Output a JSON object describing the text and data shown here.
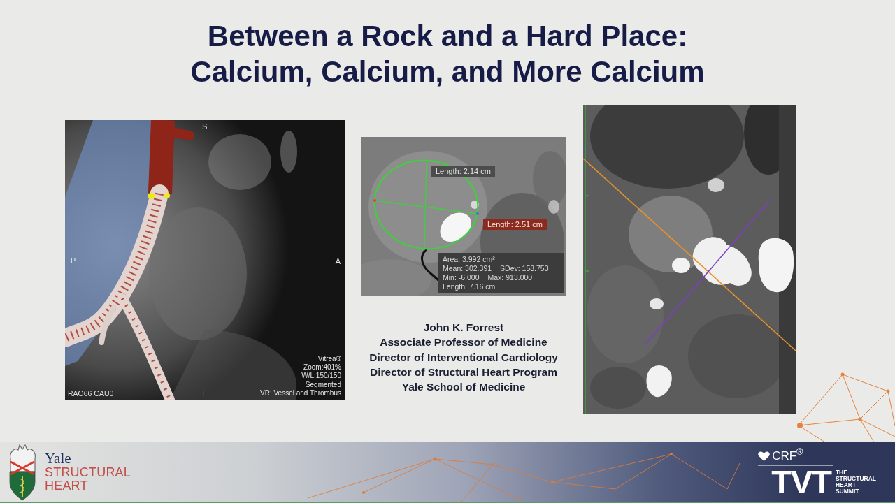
{
  "slide": {
    "title": [
      "Between a Rock and a Hard Place:",
      "Calcium, Calcium, and More Calcium"
    ]
  },
  "figures": [
    {
      "kind": "volume_render",
      "orientation_labels": {
        "top": "S",
        "left": "P",
        "right": "A",
        "bottom": "I"
      },
      "view": "RAO66 CAU0",
      "info": [
        "Vitrea®",
        "Zoom:401%",
        "W/L:150/150",
        "Segmented",
        "VR: Vessel and Thrombus"
      ]
    },
    {
      "kind": "measurement",
      "length_labels": [
        {
          "text": "Length: 2.14 cm",
          "highlighted": false
        },
        {
          "text": "Length: 2.51 cm",
          "highlighted": true
        }
      ],
      "stats": [
        [
          "Area: 3.992 cm²"
        ],
        [
          "Mean: 302.391",
          "SDev: 158.753"
        ],
        [
          "Min: -6.000",
          "Max: 913.000"
        ],
        [
          "Length: 7.16 cm"
        ]
      ]
    },
    {
      "kind": "ct_slice"
    }
  ],
  "speaker": {
    "name": "John K. Forrest",
    "titles": [
      "Associate Professor of Medicine",
      "Director of Interventional Cardiology",
      "Director of Structural Heart Program",
      "Yale School of Medicine"
    ]
  },
  "footer": {
    "left_logo": {
      "name": "Yale",
      "lines": [
        "STRUCTURAL",
        "HEART"
      ]
    },
    "right_logo": {
      "brand": "CRF$^{®}$",
      "event": "TVT",
      "tagline": [
        "THE",
        "STRUCTURAL",
        "HEART",
        "SUMMIT"
      ]
    }
  }
}
